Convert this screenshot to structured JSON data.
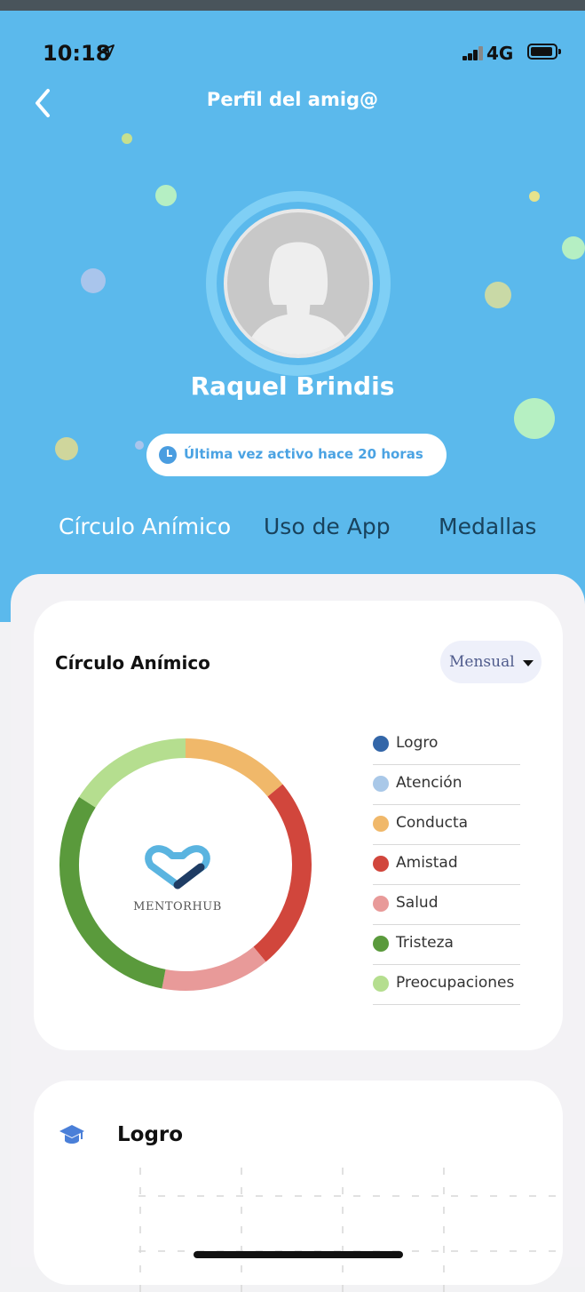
{
  "status_bar": {
    "time": "10:18",
    "location_icon": "location-arrow-icon",
    "network": "4G"
  },
  "header": {
    "title": "Perfil del amig@",
    "back_icon": "chevron-left-icon"
  },
  "profile": {
    "name": "Raquel Brindis",
    "last_active": "Última vez activo hace 20 horas"
  },
  "tabs": [
    {
      "label": "Círculo Anímico",
      "active": true
    },
    {
      "label": "Uso de App",
      "active": false
    },
    {
      "label": "Medallas",
      "active": false
    }
  ],
  "mood_card": {
    "title": "Círculo Anímico",
    "period": "Mensual",
    "logo_text": "MentorHub",
    "legend": [
      {
        "label": "Logro",
        "color": "#3366a8"
      },
      {
        "label": "Atención",
        "color": "#a9c8e8"
      },
      {
        "label": "Conducta",
        "color": "#f0b86a"
      },
      {
        "label": "Amistad",
        "color": "#d1463c"
      },
      {
        "label": "Salud",
        "color": "#e89a99"
      },
      {
        "label": "Tristeza",
        "color": "#5a9a3c"
      },
      {
        "label": "Preocupaciones",
        "color": "#b5de8f"
      }
    ],
    "segments": [
      {
        "label": "Conducta",
        "percent": 14
      },
      {
        "label": "Amistad",
        "percent": 25
      },
      {
        "label": "Salud",
        "percent": 14
      },
      {
        "label": "Tristeza",
        "percent": 31
      },
      {
        "label": "Preocupaciones",
        "percent": 16
      }
    ]
  },
  "logro_card": {
    "title": "Logro"
  }
}
